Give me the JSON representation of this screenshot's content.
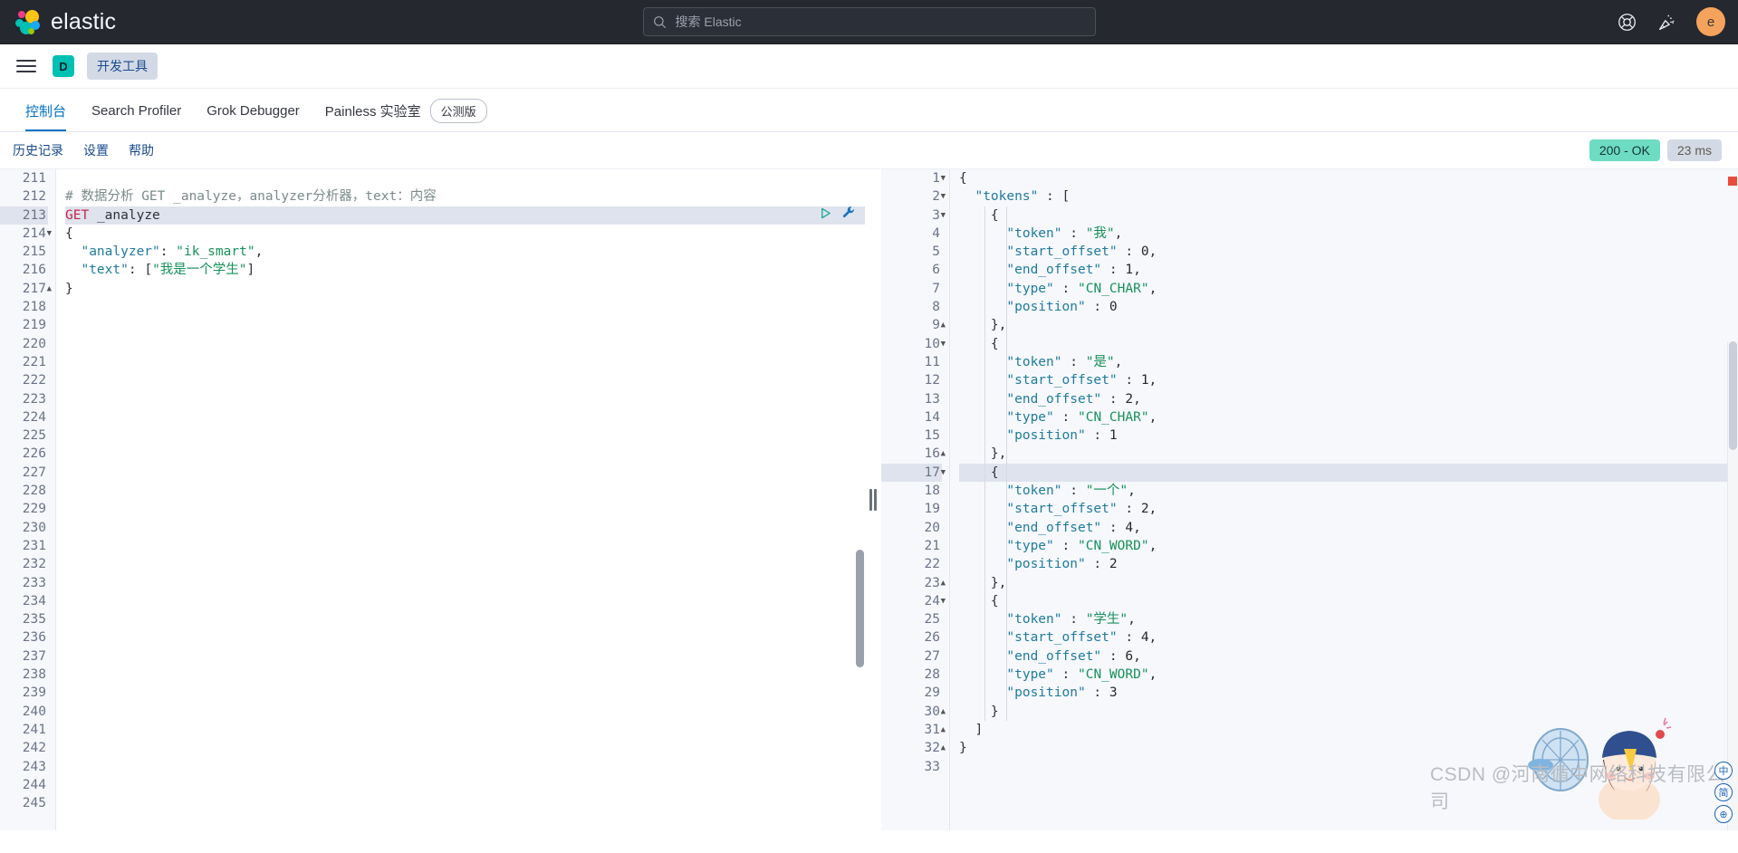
{
  "header": {
    "brand": "elastic",
    "logo_colors": [
      "#ee3d8a",
      "#fec514",
      "#00bfb3",
      "#00bfb3",
      "#1ba9f5",
      "#93c90e"
    ],
    "search": {
      "placeholder": "搜索 Elastic",
      "value": ""
    },
    "help_icon": "lifering-icon",
    "news_icon": "party-popper-icon",
    "avatar_initial": "e",
    "avatar_color": "#f5a35c"
  },
  "breadcrumb": {
    "menu_icon": "hamburger-menu-icon",
    "app_initial": "D",
    "app_badge_color": "#00bfb3",
    "crumb_label": "开发工具"
  },
  "tabs": [
    {
      "label": "控制台",
      "active": true,
      "badge": null
    },
    {
      "label": "Search Profiler",
      "active": false,
      "badge": null
    },
    {
      "label": "Grok Debugger",
      "active": false,
      "badge": null
    },
    {
      "label": "Painless 实验室",
      "active": false,
      "badge": "公测版"
    }
  ],
  "toolbar": {
    "items": [
      "历史记录",
      "设置",
      "帮助"
    ],
    "status_code": "200 - OK",
    "status_color": "#6ddcc2",
    "duration": "23 ms"
  },
  "request_editor": {
    "first_line_number": 211,
    "last_line_number": 245,
    "active_line": 213,
    "play_icon": "play-triangle-icon",
    "wrench_icon": "wrench-icon",
    "lines": [
      {
        "n": 211,
        "fold": null,
        "tokens": []
      },
      {
        "n": 212,
        "fold": null,
        "tokens": [
          {
            "t": "comment",
            "v": "# 数据分析 GET _analyze，analyzer分析器，text：内容"
          }
        ]
      },
      {
        "n": 213,
        "fold": null,
        "highlight": true,
        "actions": true,
        "tokens": [
          {
            "t": "method",
            "v": "GET"
          },
          {
            "t": "plain",
            "v": " "
          },
          {
            "t": "url",
            "v": "_analyze"
          }
        ]
      },
      {
        "n": 214,
        "fold": "down",
        "tokens": [
          {
            "t": "punc",
            "v": "{"
          }
        ]
      },
      {
        "n": 215,
        "fold": null,
        "tokens": [
          {
            "t": "plain",
            "v": "  "
          },
          {
            "t": "key",
            "v": "\"analyzer\""
          },
          {
            "t": "punc",
            "v": ": "
          },
          {
            "t": "str",
            "v": "\"ik_smart\""
          },
          {
            "t": "punc",
            "v": ","
          }
        ]
      },
      {
        "n": 216,
        "fold": null,
        "tokens": [
          {
            "t": "plain",
            "v": "  "
          },
          {
            "t": "key",
            "v": "\"text\""
          },
          {
            "t": "punc",
            "v": ": ["
          },
          {
            "t": "str",
            "v": "\"我是一个学生\""
          },
          {
            "t": "punc",
            "v": "]"
          }
        ]
      },
      {
        "n": 217,
        "fold": "up",
        "tokens": [
          {
            "t": "punc",
            "v": "}"
          }
        ]
      },
      {
        "n": 218,
        "fold": null,
        "tokens": []
      },
      {
        "n": 219,
        "fold": null,
        "tokens": []
      },
      {
        "n": 220,
        "fold": null,
        "tokens": []
      },
      {
        "n": 221,
        "fold": null,
        "tokens": []
      },
      {
        "n": 222,
        "fold": null,
        "tokens": []
      },
      {
        "n": 223,
        "fold": null,
        "tokens": []
      },
      {
        "n": 224,
        "fold": null,
        "tokens": []
      },
      {
        "n": 225,
        "fold": null,
        "tokens": []
      },
      {
        "n": 226,
        "fold": null,
        "tokens": []
      },
      {
        "n": 227,
        "fold": null,
        "tokens": []
      },
      {
        "n": 228,
        "fold": null,
        "tokens": []
      },
      {
        "n": 229,
        "fold": null,
        "tokens": []
      },
      {
        "n": 230,
        "fold": null,
        "tokens": []
      },
      {
        "n": 231,
        "fold": null,
        "tokens": []
      },
      {
        "n": 232,
        "fold": null,
        "tokens": []
      },
      {
        "n": 233,
        "fold": null,
        "tokens": []
      },
      {
        "n": 234,
        "fold": null,
        "tokens": []
      },
      {
        "n": 235,
        "fold": null,
        "tokens": []
      },
      {
        "n": 236,
        "fold": null,
        "tokens": []
      },
      {
        "n": 237,
        "fold": null,
        "tokens": []
      },
      {
        "n": 238,
        "fold": null,
        "tokens": []
      },
      {
        "n": 239,
        "fold": null,
        "tokens": []
      },
      {
        "n": 240,
        "fold": null,
        "tokens": []
      },
      {
        "n": 241,
        "fold": null,
        "tokens": []
      },
      {
        "n": 242,
        "fold": null,
        "tokens": []
      },
      {
        "n": 243,
        "fold": null,
        "tokens": []
      },
      {
        "n": 244,
        "fold": null,
        "tokens": []
      },
      {
        "n": 245,
        "fold": null,
        "tokens": []
      }
    ]
  },
  "response_editor": {
    "active_line": 17,
    "lines": [
      {
        "n": 1,
        "fold": "down",
        "tokens": [
          {
            "t": "punc",
            "v": "{"
          }
        ]
      },
      {
        "n": 2,
        "fold": "down",
        "tokens": [
          {
            "t": "plain",
            "v": "  "
          },
          {
            "t": "key",
            "v": "\"tokens\""
          },
          {
            "t": "punc",
            "v": " : ["
          }
        ]
      },
      {
        "n": 3,
        "fold": "down",
        "tokens": [
          {
            "t": "plain",
            "v": "    "
          },
          {
            "t": "punc",
            "v": "{"
          }
        ]
      },
      {
        "n": 4,
        "fold": null,
        "tokens": [
          {
            "t": "plain",
            "v": "      "
          },
          {
            "t": "key",
            "v": "\"token\""
          },
          {
            "t": "punc",
            "v": " : "
          },
          {
            "t": "str",
            "v": "\"我\""
          },
          {
            "t": "punc",
            "v": ","
          }
        ]
      },
      {
        "n": 5,
        "fold": null,
        "tokens": [
          {
            "t": "plain",
            "v": "      "
          },
          {
            "t": "key",
            "v": "\"start_offset\""
          },
          {
            "t": "punc",
            "v": " : "
          },
          {
            "t": "num",
            "v": "0"
          },
          {
            "t": "punc",
            "v": ","
          }
        ]
      },
      {
        "n": 6,
        "fold": null,
        "tokens": [
          {
            "t": "plain",
            "v": "      "
          },
          {
            "t": "key",
            "v": "\"end_offset\""
          },
          {
            "t": "punc",
            "v": " : "
          },
          {
            "t": "num",
            "v": "1"
          },
          {
            "t": "punc",
            "v": ","
          }
        ]
      },
      {
        "n": 7,
        "fold": null,
        "tokens": [
          {
            "t": "plain",
            "v": "      "
          },
          {
            "t": "key",
            "v": "\"type\""
          },
          {
            "t": "punc",
            "v": " : "
          },
          {
            "t": "str",
            "v": "\"CN_CHAR\""
          },
          {
            "t": "punc",
            "v": ","
          }
        ]
      },
      {
        "n": 8,
        "fold": null,
        "tokens": [
          {
            "t": "plain",
            "v": "      "
          },
          {
            "t": "key",
            "v": "\"position\""
          },
          {
            "t": "punc",
            "v": " : "
          },
          {
            "t": "num",
            "v": "0"
          }
        ]
      },
      {
        "n": 9,
        "fold": "up",
        "tokens": [
          {
            "t": "plain",
            "v": "    "
          },
          {
            "t": "punc",
            "v": "},"
          }
        ]
      },
      {
        "n": 10,
        "fold": "down",
        "tokens": [
          {
            "t": "plain",
            "v": "    "
          },
          {
            "t": "punc",
            "v": "{"
          }
        ]
      },
      {
        "n": 11,
        "fold": null,
        "tokens": [
          {
            "t": "plain",
            "v": "      "
          },
          {
            "t": "key",
            "v": "\"token\""
          },
          {
            "t": "punc",
            "v": " : "
          },
          {
            "t": "str",
            "v": "\"是\""
          },
          {
            "t": "punc",
            "v": ","
          }
        ]
      },
      {
        "n": 12,
        "fold": null,
        "tokens": [
          {
            "t": "plain",
            "v": "      "
          },
          {
            "t": "key",
            "v": "\"start_offset\""
          },
          {
            "t": "punc",
            "v": " : "
          },
          {
            "t": "num",
            "v": "1"
          },
          {
            "t": "punc",
            "v": ","
          }
        ]
      },
      {
        "n": 13,
        "fold": null,
        "tokens": [
          {
            "t": "plain",
            "v": "      "
          },
          {
            "t": "key",
            "v": "\"end_offset\""
          },
          {
            "t": "punc",
            "v": " : "
          },
          {
            "t": "num",
            "v": "2"
          },
          {
            "t": "punc",
            "v": ","
          }
        ]
      },
      {
        "n": 14,
        "fold": null,
        "tokens": [
          {
            "t": "plain",
            "v": "      "
          },
          {
            "t": "key",
            "v": "\"type\""
          },
          {
            "t": "punc",
            "v": " : "
          },
          {
            "t": "str",
            "v": "\"CN_CHAR\""
          },
          {
            "t": "punc",
            "v": ","
          }
        ]
      },
      {
        "n": 15,
        "fold": null,
        "tokens": [
          {
            "t": "plain",
            "v": "      "
          },
          {
            "t": "key",
            "v": "\"position\""
          },
          {
            "t": "punc",
            "v": " : "
          },
          {
            "t": "num",
            "v": "1"
          }
        ]
      },
      {
        "n": 16,
        "fold": "up",
        "tokens": [
          {
            "t": "plain",
            "v": "    "
          },
          {
            "t": "punc",
            "v": "},"
          }
        ]
      },
      {
        "n": 17,
        "fold": "down",
        "highlight": true,
        "tokens": [
          {
            "t": "plain",
            "v": "    "
          },
          {
            "t": "punc",
            "v": "{"
          }
        ]
      },
      {
        "n": 18,
        "fold": null,
        "tokens": [
          {
            "t": "plain",
            "v": "      "
          },
          {
            "t": "key",
            "v": "\"token\""
          },
          {
            "t": "punc",
            "v": " : "
          },
          {
            "t": "str",
            "v": "\"一个\""
          },
          {
            "t": "punc",
            "v": ","
          }
        ]
      },
      {
        "n": 19,
        "fold": null,
        "tokens": [
          {
            "t": "plain",
            "v": "      "
          },
          {
            "t": "key",
            "v": "\"start_offset\""
          },
          {
            "t": "punc",
            "v": " : "
          },
          {
            "t": "num",
            "v": "2"
          },
          {
            "t": "punc",
            "v": ","
          }
        ]
      },
      {
        "n": 20,
        "fold": null,
        "tokens": [
          {
            "t": "plain",
            "v": "      "
          },
          {
            "t": "key",
            "v": "\"end_offset\""
          },
          {
            "t": "punc",
            "v": " : "
          },
          {
            "t": "num",
            "v": "4"
          },
          {
            "t": "punc",
            "v": ","
          }
        ]
      },
      {
        "n": 21,
        "fold": null,
        "tokens": [
          {
            "t": "plain",
            "v": "      "
          },
          {
            "t": "key",
            "v": "\"type\""
          },
          {
            "t": "punc",
            "v": " : "
          },
          {
            "t": "str",
            "v": "\"CN_WORD\""
          },
          {
            "t": "punc",
            "v": ","
          }
        ]
      },
      {
        "n": 22,
        "fold": null,
        "tokens": [
          {
            "t": "plain",
            "v": "      "
          },
          {
            "t": "key",
            "v": "\"position\""
          },
          {
            "t": "punc",
            "v": " : "
          },
          {
            "t": "num",
            "v": "2"
          }
        ]
      },
      {
        "n": 23,
        "fold": "up",
        "tokens": [
          {
            "t": "plain",
            "v": "    "
          },
          {
            "t": "punc",
            "v": "},"
          }
        ]
      },
      {
        "n": 24,
        "fold": "down",
        "tokens": [
          {
            "t": "plain",
            "v": "    "
          },
          {
            "t": "punc",
            "v": "{"
          }
        ]
      },
      {
        "n": 25,
        "fold": null,
        "tokens": [
          {
            "t": "plain",
            "v": "      "
          },
          {
            "t": "key",
            "v": "\"token\""
          },
          {
            "t": "punc",
            "v": " : "
          },
          {
            "t": "str",
            "v": "\"学生\""
          },
          {
            "t": "punc",
            "v": ","
          }
        ]
      },
      {
        "n": 26,
        "fold": null,
        "tokens": [
          {
            "t": "plain",
            "v": "      "
          },
          {
            "t": "key",
            "v": "\"start_offset\""
          },
          {
            "t": "punc",
            "v": " : "
          },
          {
            "t": "num",
            "v": "4"
          },
          {
            "t": "punc",
            "v": ","
          }
        ]
      },
      {
        "n": 27,
        "fold": null,
        "tokens": [
          {
            "t": "plain",
            "v": "      "
          },
          {
            "t": "key",
            "v": "\"end_offset\""
          },
          {
            "t": "punc",
            "v": " : "
          },
          {
            "t": "num",
            "v": "6"
          },
          {
            "t": "punc",
            "v": ","
          }
        ]
      },
      {
        "n": 28,
        "fold": null,
        "tokens": [
          {
            "t": "plain",
            "v": "      "
          },
          {
            "t": "key",
            "v": "\"type\""
          },
          {
            "t": "punc",
            "v": " : "
          },
          {
            "t": "str",
            "v": "\"CN_WORD\""
          },
          {
            "t": "punc",
            "v": ","
          }
        ]
      },
      {
        "n": 29,
        "fold": null,
        "tokens": [
          {
            "t": "plain",
            "v": "      "
          },
          {
            "t": "key",
            "v": "\"position\""
          },
          {
            "t": "punc",
            "v": " : "
          },
          {
            "t": "num",
            "v": "3"
          }
        ]
      },
      {
        "n": 30,
        "fold": "up",
        "tokens": [
          {
            "t": "plain",
            "v": "    "
          },
          {
            "t": "punc",
            "v": "}"
          }
        ]
      },
      {
        "n": 31,
        "fold": "up",
        "tokens": [
          {
            "t": "plain",
            "v": "  "
          },
          {
            "t": "punc",
            "v": "]"
          }
        ]
      },
      {
        "n": 32,
        "fold": "up",
        "tokens": [
          {
            "t": "punc",
            "v": "}"
          }
        ]
      },
      {
        "n": 33,
        "fold": null,
        "tokens": []
      }
    ]
  },
  "watermark": {
    "text": "CSDN @河南循中网络科技有限公司",
    "ime_badges": [
      "中",
      "简",
      "⊕"
    ]
  }
}
